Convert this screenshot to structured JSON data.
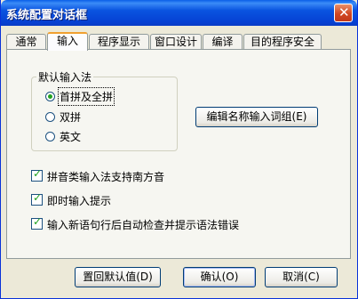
{
  "window": {
    "title": "系统配置对话框"
  },
  "tabs": [
    {
      "label": "通常"
    },
    {
      "label": "输入"
    },
    {
      "label": "程序显示"
    },
    {
      "label": "窗口设计"
    },
    {
      "label": "编译"
    },
    {
      "label": "目的程序安全"
    }
  ],
  "input_method": {
    "group_label": "默认输入法",
    "options": [
      {
        "label": "首拼及全拼",
        "selected": true
      },
      {
        "label": "双拼",
        "selected": false
      },
      {
        "label": "英文",
        "selected": false
      }
    ],
    "edit_button": "编辑名称输入词组(E)"
  },
  "checkboxes": [
    {
      "label": "拼音类输入法支持南方音",
      "checked": true
    },
    {
      "label": "即时输入提示",
      "checked": true
    },
    {
      "label": "输入新语句行后自动检查并提示语法错误",
      "checked": true
    }
  ],
  "buttons": {
    "reset": "置回默认值(D)",
    "ok": "确认(O)",
    "cancel": "取消(C)"
  },
  "icons": {
    "close": "close-icon",
    "check": "check-mark-icon",
    "radio": "radio-dot-icon"
  }
}
